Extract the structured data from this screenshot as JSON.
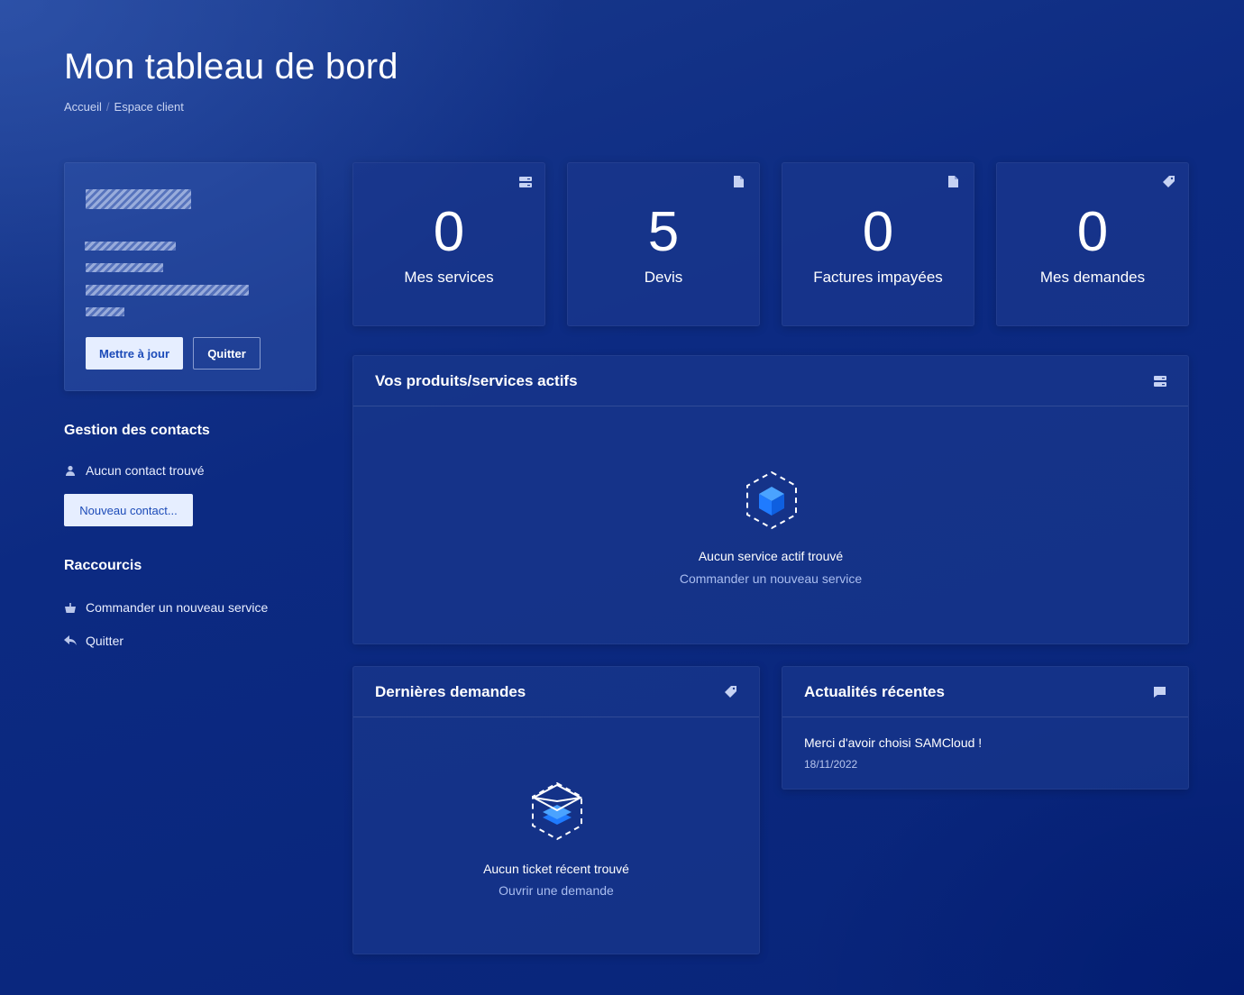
{
  "header": {
    "title": "Mon tableau de bord",
    "breadcrumb": [
      "Accueil",
      "Espace client"
    ]
  },
  "profile": {
    "update_label": "Mettre à jour",
    "logout_label": "Quitter"
  },
  "contacts": {
    "title": "Gestion des contacts",
    "empty_text": "Aucun contact trouvé",
    "new_contact_label": "Nouveau contact..."
  },
  "shortcuts": {
    "title": "Raccourcis",
    "items": [
      {
        "label": "Commander un nouveau service",
        "icon": "basket-icon"
      },
      {
        "label": "Quitter",
        "icon": "reply-arrow-icon"
      }
    ]
  },
  "stats": [
    {
      "value": "0",
      "label": "Mes services",
      "icon": "server-icon"
    },
    {
      "value": "5",
      "label": "Devis",
      "icon": "document-icon"
    },
    {
      "value": "0",
      "label": "Factures impayées",
      "icon": "document-icon"
    },
    {
      "value": "0",
      "label": "Mes demandes",
      "icon": "tag-icon"
    }
  ],
  "services_panel": {
    "title": "Vos produits/services actifs",
    "icon": "server-icon",
    "empty_title": "Aucun service actif trouvé",
    "empty_link": "Commander un nouveau service"
  },
  "tickets_panel": {
    "title": "Dernières demandes",
    "icon": "tag-icon",
    "empty_title": "Aucun ticket récent trouvé",
    "empty_link": "Ouvrir une demande"
  },
  "news_panel": {
    "title": "Actualités récentes",
    "icon": "comment-icon",
    "items": [
      {
        "title": "Merci d'avoir choisi SAMCloud !",
        "date": "18/11/2022"
      }
    ]
  },
  "colors": {
    "background": "#0b2a7e",
    "card": "#19378c",
    "accent_light": "#e6eeff",
    "link": "#a9bdf0",
    "cube_blue": "#1f7bff"
  }
}
